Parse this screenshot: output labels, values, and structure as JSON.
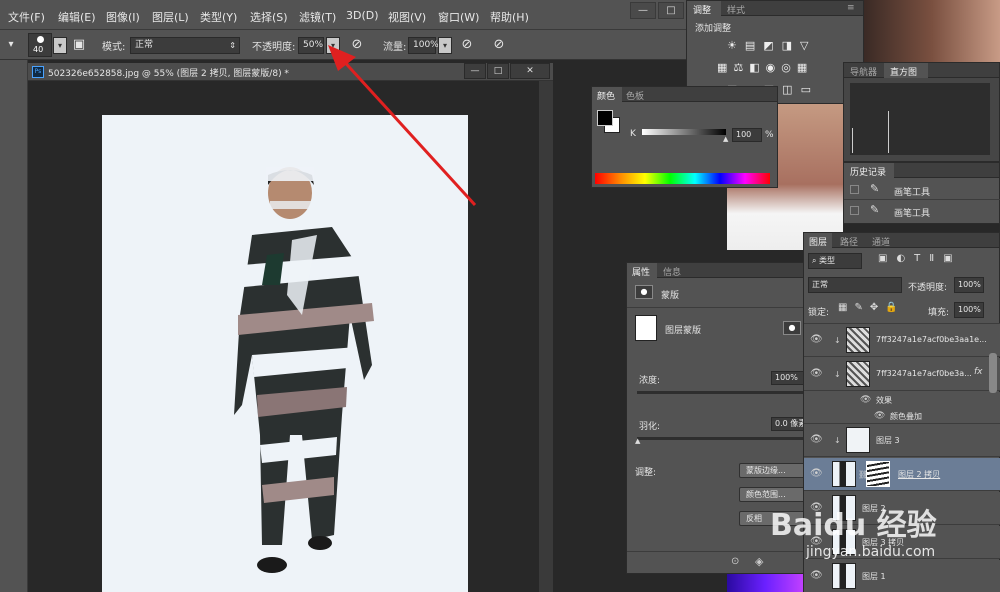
{
  "menu": [
    "文件(F)",
    "编辑(E)",
    "图像(I)",
    "图层(L)",
    "类型(Y)",
    "选择(S)",
    "滤镜(T)",
    "3D(D)",
    "视图(V)",
    "窗口(W)",
    "帮助(H)"
  ],
  "window_controls": {
    "minimize": "—",
    "maximize": "□",
    "close": "✕"
  },
  "options_bar": {
    "brush_size": "40",
    "mode_label": "模式:",
    "mode_value": "正常",
    "opacity_label": "不透明度:",
    "opacity_value": "50%",
    "flow_label": "流量:",
    "flow_value": "100%"
  },
  "document": {
    "ps_badge": "Ps",
    "tab_title": "502326e652858.jpg @ 55% (图层 2 拷贝, 图层蒙版/8) *"
  },
  "adjustments_panel": {
    "tabs": [
      "调整",
      "样式"
    ],
    "title": "添加调整"
  },
  "color_panel": {
    "tabs": [
      "颜色",
      "色板"
    ],
    "channel_label": "K",
    "value": "100",
    "unit": "%"
  },
  "histogram_panel": {
    "tabs": [
      "导航器",
      "直方图"
    ]
  },
  "history_panel": {
    "tabs": [
      "历史记录"
    ],
    "items": [
      "画笔工具",
      "画笔工具"
    ]
  },
  "properties_panel": {
    "tabs": [
      "属性",
      "信息"
    ],
    "header": "蒙版",
    "mask_label": "图层蒙版",
    "density_label": "浓度:",
    "density_value": "100%",
    "feather_label": "羽化:",
    "feather_value": "0.0 像素",
    "adjust_label": "调整:",
    "buttons": [
      "蒙版边缘...",
      "颜色范围...",
      "反相"
    ]
  },
  "layers_panel": {
    "tabs": [
      "图层",
      "路径",
      "通道"
    ],
    "filter_value": "类型",
    "blend_mode": "正常",
    "opacity_label": "不透明度:",
    "opacity_value": "100%",
    "lock_label": "锁定:",
    "fill_label": "填充:",
    "fill_value": "100%",
    "layers": [
      {
        "name": "7ff3247a1e7acf0be3aa1e...",
        "fx": ""
      },
      {
        "name": "7ff3247a1e7acf0be3a...",
        "fx": "fx"
      },
      {
        "name": "效果",
        "fx": ""
      },
      {
        "name": "颜色叠加",
        "fx": ""
      },
      {
        "name": "图层 3",
        "fx": ""
      },
      {
        "name": "图层 2 拷贝",
        "fx": ""
      },
      {
        "name": "图层 2",
        "fx": ""
      },
      {
        "name": "图层 3 拷贝",
        "fx": ""
      },
      {
        "name": "图层 1",
        "fx": ""
      }
    ]
  },
  "watermark": {
    "line1": "Baidu 经验",
    "line2": "jingyan.baidu.com"
  }
}
